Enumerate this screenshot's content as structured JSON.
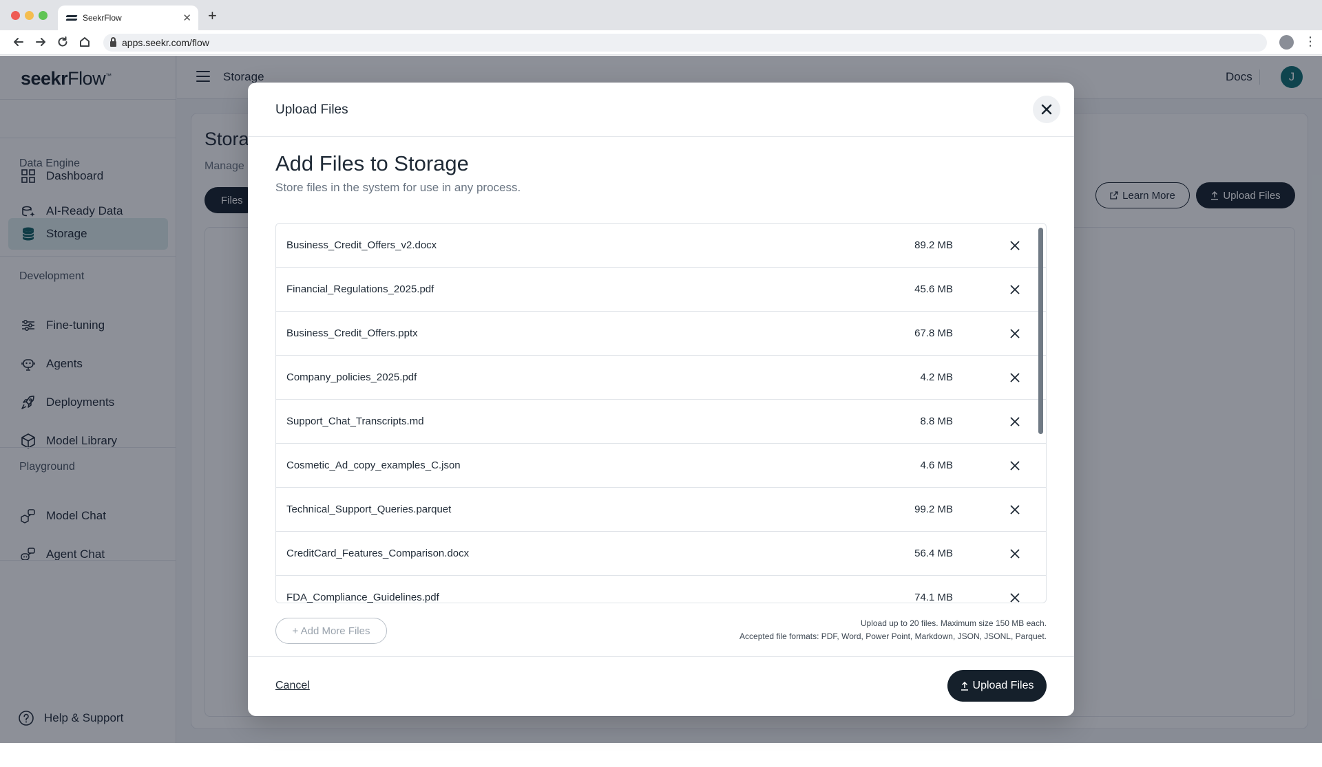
{
  "browser": {
    "tab_title": "SeekrFlow",
    "url": "apps.seekr.com/flow"
  },
  "brand": {
    "name_bold": "seekr",
    "name_regular": "Flow",
    "mark": "™"
  },
  "sidebar": {
    "dashboard": "Dashboard",
    "section_data_engine": "Data Engine",
    "ai_ready_data": "AI-Ready Data",
    "storage": "Storage",
    "section_development": "Development",
    "fine_tuning": "Fine-tuning",
    "agents": "Agents",
    "deployments": "Deployments",
    "model_library": "Model Library",
    "section_playground": "Playground",
    "model_chat": "Model Chat",
    "agent_chat": "Agent Chat",
    "help": "Help & Support"
  },
  "topbar": {
    "breadcrumb": "Storage",
    "docs": "Docs",
    "avatar_initial": "J"
  },
  "page": {
    "title": "Stora",
    "subtitle": "Manage",
    "files_tab": "Files",
    "learn_more": "Learn More",
    "upload_files": "Upload Files"
  },
  "modal": {
    "header_title": "Upload Files",
    "heading": "Add Files to Storage",
    "subheading": "Store files in the system for use in any process.",
    "files": [
      {
        "name": "Business_Credit_Offers_v2.docx",
        "size": "89.2 MB"
      },
      {
        "name": "Financial_Regulations_2025.pdf",
        "size": "45.6 MB"
      },
      {
        "name": "Business_Credit_Offers.pptx",
        "size": "67.8 MB"
      },
      {
        "name": "Company_policies_2025.pdf",
        "size": "4.2 MB"
      },
      {
        "name": "Support_Chat_Transcripts.md",
        "size": "8.8 MB"
      },
      {
        "name": "Cosmetic_Ad_copy_examples_C.json",
        "size": "4.6 MB"
      },
      {
        "name": "Technical_Support_Queries.parquet",
        "size": "99.2 MB"
      },
      {
        "name": "CreditCard_Features_Comparison.docx",
        "size": "56.4 MB"
      },
      {
        "name": "FDA_Compliance_Guidelines.pdf",
        "size": "74.1 MB"
      }
    ],
    "add_more": "+ Add More Files",
    "hint_line1": "Upload up to 20 files. Maximum size 150 MB each.",
    "hint_line2": "Accepted file formats: PDF, Word, Power Point, Markdown, JSON, JSONL, Parquet.",
    "cancel": "Cancel",
    "upload": "Upload Files"
  },
  "icons": {
    "dashboard": "grid-icon",
    "ai_ready_data": "data-sparkle-icon",
    "storage": "database-icon",
    "fine_tuning": "sliders-icon",
    "agents": "robot-icon",
    "deployments": "rocket-icon",
    "model_library": "cube-icon",
    "model_chat": "chat-cube-icon",
    "agent_chat": "chat-robot-icon",
    "help": "question-icon",
    "remove": "x-icon",
    "upload": "upload-icon",
    "external": "external-link-icon"
  },
  "colors": {
    "primary": "#15202b",
    "accent": "#0f6e72",
    "active_bg": "#dfeeee"
  }
}
